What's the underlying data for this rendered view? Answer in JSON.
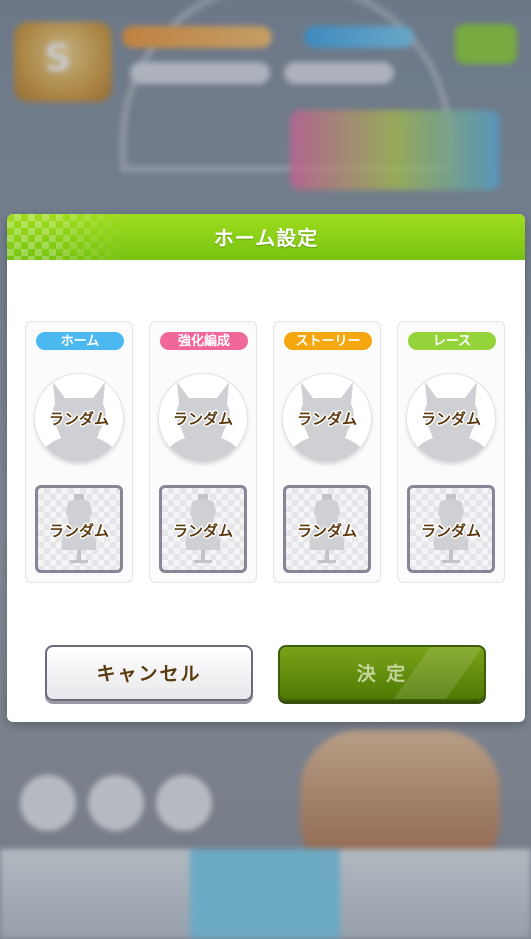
{
  "dialog": {
    "title": "ホーム設定",
    "slots": [
      {
        "tag": "ホーム",
        "tag_color": "#4bb8f0",
        "avatar_label": "ランダム",
        "outfit_label": "ランダム"
      },
      {
        "tag": "強化編成",
        "tag_color": "#f2679a",
        "avatar_label": "ランダム",
        "outfit_label": "ランダム"
      },
      {
        "tag": "ストーリー",
        "tag_color": "#f5a70f",
        "avatar_label": "ランダム",
        "outfit_label": "ランダム"
      },
      {
        "tag": "レース",
        "tag_color": "#94d43a",
        "avatar_label": "ランダム",
        "outfit_label": "ランダム"
      }
    ],
    "cancel_label": "キャンセル",
    "confirm_label": "決 定"
  },
  "colors": {
    "header_green": "#86cc17",
    "confirm_green": "#5f8c0c",
    "label_brown": "#5b3a10"
  }
}
